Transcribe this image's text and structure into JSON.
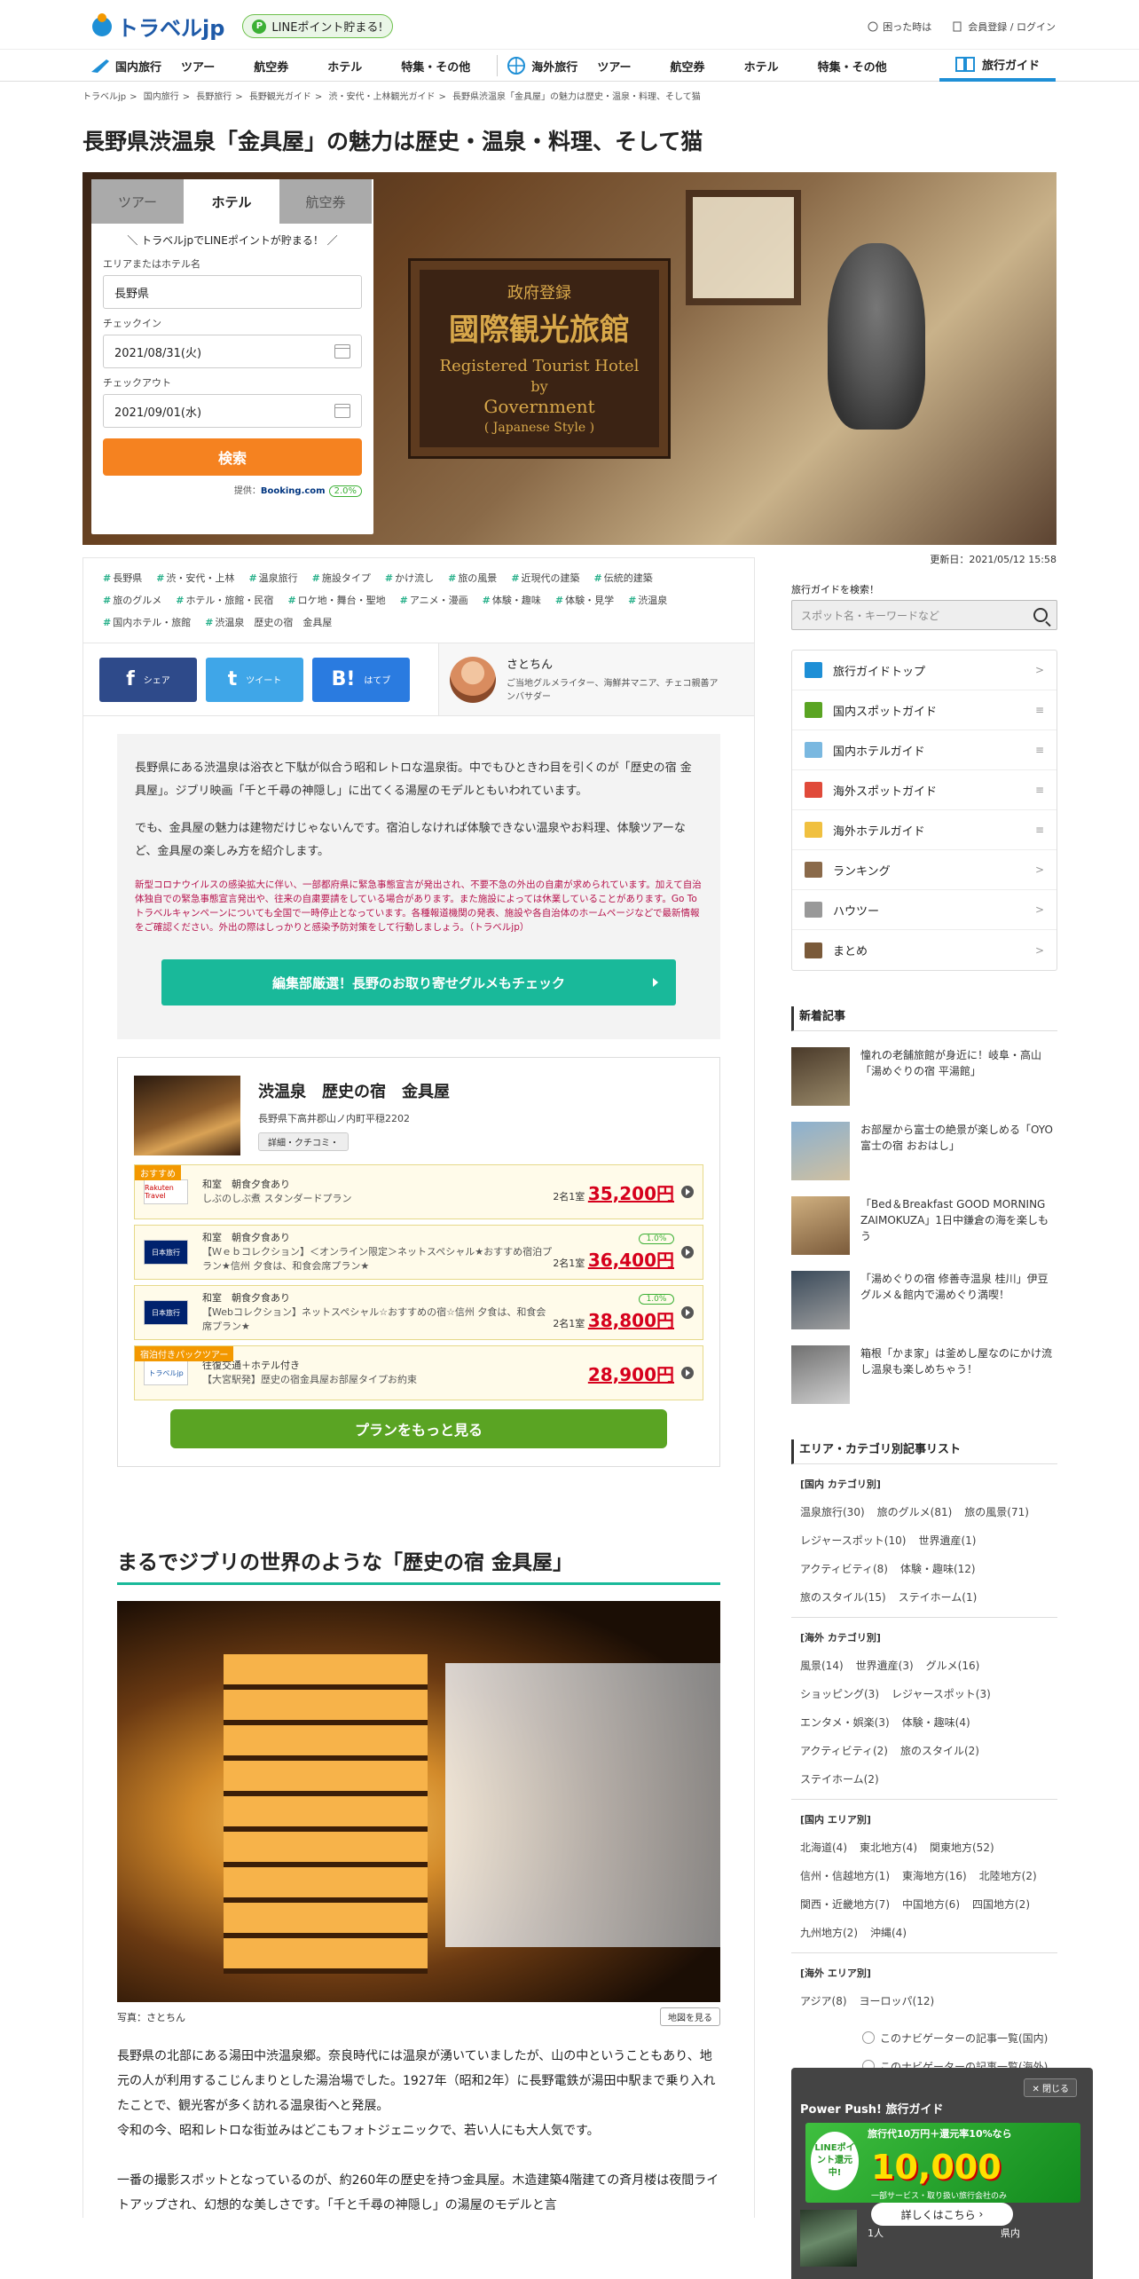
{
  "header": {
    "logo": "トラベルjp",
    "line_badge": "LINEポイント貯まる!",
    "line_p": "P",
    "help": "困った時は",
    "login": "会員登録 / ログイン"
  },
  "nav": {
    "domestic": "国内旅行",
    "domestic_items": [
      "ツアー",
      "航空券",
      "ホテル",
      "特集・その他"
    ],
    "overseas": "海外旅行",
    "overseas_items": [
      "ツアー",
      "航空券",
      "ホテル",
      "特集・その他"
    ],
    "guide": "旅行ガイド"
  },
  "breadcrumb": [
    "トラベルjp",
    ">",
    "国内旅行",
    ">",
    "長野旅行",
    ">",
    "長野観光ガイド",
    ">",
    "渋・安代・上林観光ガイド",
    ">",
    "長野県渋温泉「金具屋」の魅力は歴史・温泉・料理、そして猫"
  ],
  "title": "長野県渋温泉「金具屋」の魅力は歴史・温泉・料理、そして猫",
  "hero": {
    "plaque_jp1": "政府登録",
    "plaque_jp2": "國際観光旅館",
    "plaque_en1": "Registered Tourist Hotel",
    "plaque_en2": "by",
    "plaque_en3": "Government",
    "plaque_en4": "( Japanese Style )"
  },
  "search": {
    "tabs": [
      "ツアー",
      "ホテル",
      "航空券"
    ],
    "message": "＼ トラベルjpでLINEポイントが貯まる！ ／",
    "area_label": "エリアまたはホテル名",
    "area_value": "長野県",
    "checkin_label": "チェックイン",
    "checkin_value": "2021/08/31(火)",
    "checkout_label": "チェックアウト",
    "checkout_value": "2021/09/01(水)",
    "button": "検索",
    "provider": "提供：",
    "provider_name": "Booking.com",
    "points": "2.0%"
  },
  "updated": "更新日：2021/05/12 15:58",
  "tags": [
    "長野県",
    "渋・安代・上林",
    "温泉旅行",
    "施設タイプ",
    "かけ流し",
    "旅の風景",
    "近現代の建築",
    "伝統的建築",
    "旅のグルメ",
    "ホテル・旅館・民宿",
    "ロケ地・舞台・聖地",
    "アニメ・漫画",
    "体験・趣味",
    "体験・見学",
    "渋温泉",
    "国内ホテル・旅館",
    "渋温泉　歴史の宿　金具屋"
  ],
  "share": {
    "facebook": "シェア",
    "facebook_glyph": "f",
    "twitter": "ツイート",
    "twitter_glyph": "t",
    "hatena": "はてブ",
    "hatena_glyph": "B!"
  },
  "author": {
    "name": "さとちん",
    "desc": "ご当地グルメライター、海鮮丼マニア、チェコ親善アンバサダー"
  },
  "intro": {
    "p1": "長野県にある渋温泉は浴衣と下駄が似合う昭和レトロな温泉街。中でもひときわ目を引くのが「歴史の宿 金具屋」。ジブリ映画「千と千尋の神隠し」に出てくる湯屋のモデルともいわれています。",
    "p2": "でも、金具屋の魅力は建物だけじゃないんです。宿泊しなければ体験できない温泉やお料理、体験ツアーなど、金具屋の楽しみ方を紹介します。",
    "warn": "新型コロナウイルスの感染拡大に伴い、一部都府県に緊急事態宣言が発出され、不要不急の外出の自粛が求められています。加えて自治体独自での緊急事態宣言発出や、往来の自粛要請をしている場合があります。また施設によっては休業していることがあります。Go To トラベルキャンペーンについても全国で一時停止となっています。各種報道機関の発表、施設や各自治体のホームページなどで最新情報をご確認ください。外出の際はしっかりと感染予防対策をして行動しましょう。（トラベルjp）",
    "button": "編集部厳選！長野のお取り寄せグルメもチェック"
  },
  "hotel": {
    "name": "渋温泉　歴史の宿　金具屋",
    "address": "長野県下高井郡山ノ内町平穏2202",
    "detail_btn": "詳細・クチコミ・",
    "plans": [
      {
        "label": "おすすめ",
        "vendor": "Rakuten Travel",
        "vclass": "",
        "line1": "和室　朝食夕食あり",
        "line2": "しぶのしぶ煮 スタンダードプラン",
        "per": "2名1室",
        "price": "35,200円",
        "pt": ""
      },
      {
        "label": "",
        "vendor": "日本旅行",
        "vclass": "jtb",
        "line1": "和室　朝食夕食あり",
        "line2": "【Ｗｅｂコレクション】＜オンライン限定＞ネットスペシャル★おすすめ宿泊プラン★信州 夕食は、和食会席プラン★",
        "per": "2名1室",
        "price": "36,400円",
        "pt": "1.0%"
      },
      {
        "label": "",
        "vendor": "日本旅行",
        "vclass": "jtb",
        "line1": "和室　朝食夕食あり",
        "line2": "【Webコレクション】ネットスペシャル☆おすすめの宿☆信州 夕食は、和食会席プラン★",
        "per": "2名1室",
        "price": "38,800円",
        "pt": "1.0%"
      },
      {
        "label": "宿泊付きパックツアー",
        "vendor": "トラベルjp",
        "vclass": "tb",
        "line1": "往復交通＋ホテル付き",
        "line2": "【大宮駅発】歴史の宿金具屋お部屋タイプお約束",
        "per": "",
        "price": "28,900円",
        "pt": ""
      }
    ],
    "more_btn": "プランをもっと見る"
  },
  "section": {
    "h2": "まるでジブリの世界のような「歴史の宿 金具屋」",
    "caption": "写真：さとちん",
    "map_btn": "地図を見る",
    "p1": "長野県の北部にある湯田中渋温泉郷。奈良時代には温泉が湧いていましたが、山の中ということもあり、地元の人が利用するこじんまりとした湯治場でした。1927年（昭和2年）に長野電鉄が湯田中駅まで乗り入れたことで、観光客が多く訪れる温泉街へと発展。",
    "p2": "令和の今、昭和レトロな街並みはどこもフォトジェニックで、若い人にも大人気です。",
    "p3": "一番の撮影スポットとなっているのが、約260年の歴史を持つ金具屋。木造建築4階建ての斉月楼は夜間ライトアップされ、幻想的な美しさです。「千と千尋の神隠し」の湯屋のモデルと言"
  },
  "sidebar": {
    "search_label": "旅行ガイドを検索！",
    "search_placeholder": "スポット名・キーワードなど",
    "menu": [
      "旅行ガイドトップ",
      "国内スポットガイド",
      "国内ホテルガイド",
      "海外スポットガイド",
      "海外ホテルガイド",
      "ランキング",
      "ハウツー",
      "まとめ"
    ],
    "menu_chev": [
      ">",
      "≡",
      "≡",
      "≡",
      "≡",
      ">",
      ">",
      ">"
    ],
    "news_title": "新着記事",
    "news": [
      "憧れの老舗旅館が身近に！岐阜・高山「湯めぐりの宿 平湯館」",
      "お部屋から富士の絶景が楽しめる「OYO 富士の宿 おおはし」",
      "「Bed＆Breakfast GOOD MORNING ZAIMOKUZA」1日中鎌倉の海を楽しもう",
      "「湯めぐりの宿 修善寺温泉 桂川」伊豆グルメ＆館内で湯めぐり満喫！",
      "箱根「かま家」は釜めし屋なのにかけ流し温泉も楽しめちゃう！"
    ],
    "cat_title": "エリア・カテゴリ別記事リスト",
    "groups": [
      {
        "head": "[国内 カテゴリ別]",
        "items": [
          "温泉旅行(30)",
          "旅のグルメ(81)",
          "旅の風景(71)",
          "レジャースポット(10)",
          "世界遺産(1)",
          "アクティビティ(8)",
          "体験・趣味(12)",
          "旅のスタイル(15)",
          "ステイホーム(1)"
        ]
      },
      {
        "head": "[海外 カテゴリ別]",
        "items": [
          "風景(14)",
          "世界遺産(3)",
          "グルメ(16)",
          "ショッピング(3)",
          "レジャースポット(3)",
          "エンタメ・娯楽(3)",
          "体験・趣味(4)",
          "アクティビティ(2)",
          "旅のスタイル(2)",
          "ステイホーム(2)"
        ]
      },
      {
        "head": "[国内 エリア別]",
        "items": [
          "北海道(4)",
          "東北地方(4)",
          "関東地方(52)",
          "信州・信越地方(1)",
          "東海地方(16)",
          "北陸地方(2)",
          "関西・近畿地方(7)",
          "中国地方(6)",
          "四国地方(2)",
          "九州地方(2)",
          "沖縄(4)"
        ]
      },
      {
        "head": "[海外 エリア別]",
        "items": [
          "アジア(8)",
          "ヨーロッパ(12)"
        ]
      }
    ],
    "nav_links": [
      "このナビゲーターの記事一覧(国内)",
      "このナビゲーターの記事一覧(海外)"
    ]
  },
  "popup": {
    "close": "閉じる",
    "title": "Power Push! 旅行ガイド",
    "banner_line": "LINEポイント還元中!",
    "banner_top": "旅行代10万円＋還元率10%なら",
    "banner_big": "10,000",
    "banner_btm": "一部サービス・取り扱い旅行会社のみ",
    "detail": "詳しくはこちら",
    "item_text": "1人　　　　　　　　　　　　県内"
  }
}
